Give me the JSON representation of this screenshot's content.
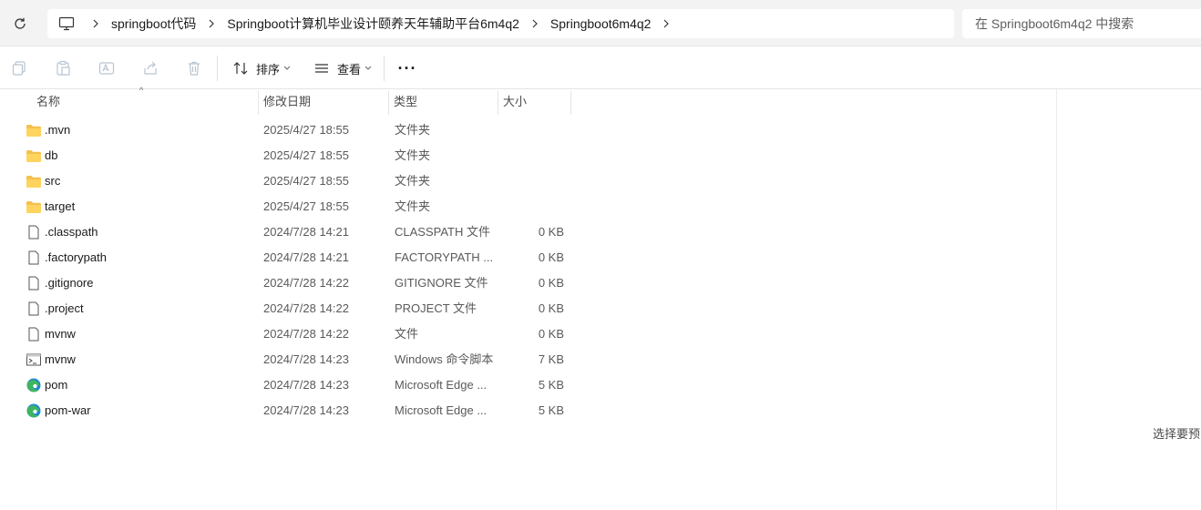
{
  "address_bar": {
    "breadcrumb": [
      "springboot代码",
      "Springboot计算机毕业设计颐养天年辅助平台6m4q2",
      "Springboot6m4q2"
    ],
    "search_placeholder": "在 Springboot6m4q2 中搜索"
  },
  "toolbar": {
    "sort_label": "排序",
    "view_label": "查看",
    "more_label": "···"
  },
  "columns": {
    "name": "名称",
    "date": "修改日期",
    "type": "类型",
    "size": "大小"
  },
  "files": [
    {
      "name": ".mvn",
      "date": "2025/4/27 18:55",
      "type": "文件夹",
      "size": "",
      "icon": "folder-icon"
    },
    {
      "name": "db",
      "date": "2025/4/27 18:55",
      "type": "文件夹",
      "size": "",
      "icon": "folder-icon"
    },
    {
      "name": "src",
      "date": "2025/4/27 18:55",
      "type": "文件夹",
      "size": "",
      "icon": "folder-icon"
    },
    {
      "name": "target",
      "date": "2025/4/27 18:55",
      "type": "文件夹",
      "size": "",
      "icon": "folder-icon"
    },
    {
      "name": ".classpath",
      "date": "2024/7/28 14:21",
      "type": "CLASSPATH 文件",
      "size": "0 KB",
      "icon": "file-icon"
    },
    {
      "name": ".factorypath",
      "date": "2024/7/28 14:21",
      "type": "FACTORYPATH ...",
      "size": "0 KB",
      "icon": "file-icon"
    },
    {
      "name": ".gitignore",
      "date": "2024/7/28 14:22",
      "type": "GITIGNORE 文件",
      "size": "0 KB",
      "icon": "file-icon"
    },
    {
      "name": ".project",
      "date": "2024/7/28 14:22",
      "type": "PROJECT 文件",
      "size": "0 KB",
      "icon": "file-icon"
    },
    {
      "name": "mvnw",
      "date": "2024/7/28 14:22",
      "type": "文件",
      "size": "0 KB",
      "icon": "file-icon"
    },
    {
      "name": "mvnw",
      "date": "2024/7/28 14:23",
      "type": "Windows 命令脚本",
      "size": "7 KB",
      "icon": "script-icon"
    },
    {
      "name": "pom",
      "date": "2024/7/28 14:23",
      "type": "Microsoft Edge ...",
      "size": "5 KB",
      "icon": "edge-icon"
    },
    {
      "name": "pom-war",
      "date": "2024/7/28 14:23",
      "type": "Microsoft Edge ...",
      "size": "5 KB",
      "icon": "edge-icon"
    }
  ],
  "preview": {
    "hint": "选择要预览"
  },
  "colors": {
    "folder": "#f4c04e",
    "edge_blue": "#1e88d8",
    "edge_green": "#3fb65b"
  }
}
